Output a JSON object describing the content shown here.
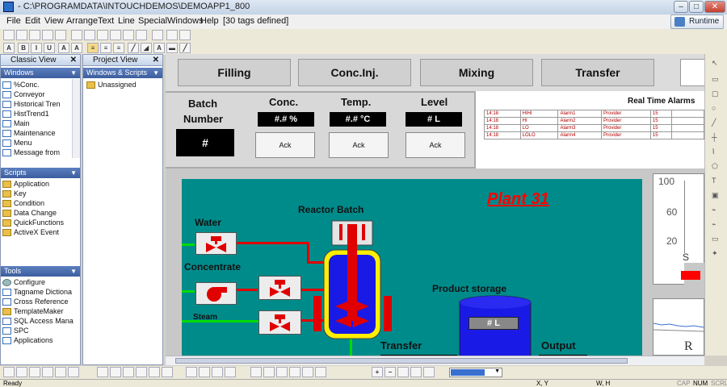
{
  "window": {
    "title": "- C:\\PROGRAMDATA\\INTOUCHDEMOS\\DEMOAPP1_800",
    "runtime_label": "Runtime"
  },
  "menu": {
    "items": [
      "File",
      "Edit",
      "View",
      "Arrange",
      "Text",
      "Line",
      "Special",
      "Windows",
      "Help"
    ],
    "tags_info": "[30 tags defined]"
  },
  "classic_view": {
    "title": "Classic View",
    "windows_header": "Windows",
    "windows": [
      "%Conc.",
      "Conveyor",
      "Historical Tren",
      "HistTrend1",
      "Main",
      "Maintenance",
      "Menu",
      "Message from"
    ],
    "scripts_header": "Scripts",
    "scripts": [
      "Application",
      "Key",
      "Condition",
      "Data Change",
      "QuickFunctions",
      "ActiveX Event"
    ],
    "tools_header": "Tools",
    "tools": [
      "Configure",
      "Tagname Dictiona",
      "Cross Reference",
      "TemplateMaker",
      "SQL Access Mana",
      "SPC",
      "Applications"
    ]
  },
  "project_view": {
    "title": "Project View",
    "dropdown": "Windows & Scripts",
    "node": "Unassigned"
  },
  "hmi": {
    "nav": [
      "Filling",
      "Conc.Inj.",
      "Mixing",
      "Transfer"
    ],
    "batch_label_1": "Batch",
    "batch_label_2": "Number",
    "batch_value": "#",
    "conc_label": "Conc.",
    "conc_value": "#.# %",
    "temp_label": "Temp.",
    "temp_value": "#.# °C",
    "level_label": "Level",
    "level_value": "# L",
    "ack_label": "Ack",
    "alarms_title": "Real Time Alarms",
    "alarms": [
      {
        "time": "14:18",
        "type": "HIHI",
        "name": "Alarm1",
        "group": "Provider",
        "prio": "15"
      },
      {
        "time": "14:18",
        "type": "HI",
        "name": "Alarm2",
        "group": "Provider",
        "prio": "15"
      },
      {
        "time": "14:18",
        "type": "LO",
        "name": "Alarm3",
        "group": "Provider",
        "prio": "15"
      },
      {
        "time": "14:18",
        "type": "LOLO",
        "name": "Alarm4",
        "group": "Provider",
        "prio": "15"
      }
    ],
    "plant_title": "Plant 31",
    "water": "Water",
    "concentrate": "Concentrate",
    "steam": "Steam",
    "reactor": "Reactor Batch",
    "product_storage": "Product storage",
    "storage_value": "# L",
    "transfer": "Transfer",
    "output": "Output",
    "trend_ticks": [
      "100",
      "60",
      "20"
    ],
    "trend_s": "S",
    "trend_r": "R"
  },
  "status": {
    "ready": "Ready",
    "xy": "X, Y",
    "wh": "W, H",
    "cap": "CAP",
    "num": "NUM",
    "scrl": "SCRL"
  },
  "colors": {
    "teal": "#008b8b",
    "pipe_red": "#e00000",
    "pipe_green": "#00dd00",
    "tank_blue": "#1a1ae6",
    "alarm_red": "#b00000"
  }
}
